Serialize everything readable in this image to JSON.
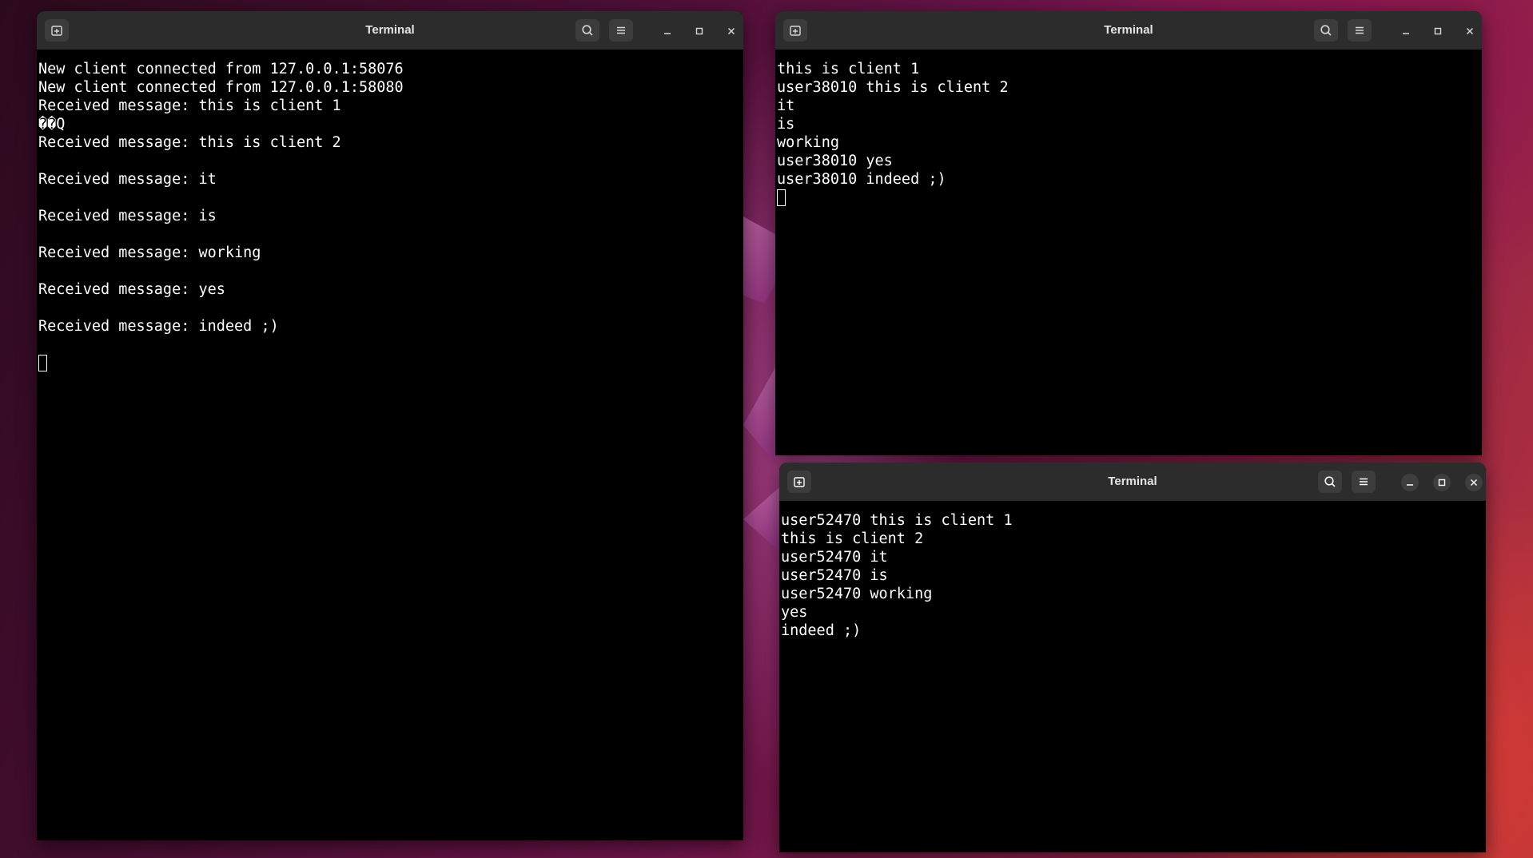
{
  "desktop": {
    "wallpaper": "ubuntu-purple-red-gradient"
  },
  "windows": [
    {
      "title": "Terminal",
      "lines": [
        "New client connected from 127.0.0.1:58076",
        "New client connected from 127.0.0.1:58080",
        "Received message: this is client 1",
        "��Q",
        "Received message: this is client 2",
        "",
        "Received message: it",
        "",
        "Received message: is",
        "",
        "Received message: working",
        "",
        "Received message: yes",
        "",
        "Received message: indeed ;)",
        ""
      ],
      "focused": false
    },
    {
      "title": "Terminal",
      "lines": [
        "this is client 1",
        "user38010 this is client 2",
        "it",
        "is",
        "working",
        "user38010 yes",
        "user38010 indeed ;)"
      ],
      "focused": false
    },
    {
      "title": "Terminal",
      "lines": [
        "user52470 this is client 1",
        "this is client 2",
        "user52470 it",
        "user52470 is",
        "user52470 working",
        "yes",
        "indeed ;)"
      ],
      "focused": true
    }
  ],
  "icons": {
    "new_tab": "new-tab-icon",
    "search": "search-icon",
    "menu": "hamburger-menu-icon",
    "minimize": "minimize-icon",
    "maximize": "maximize-icon",
    "close": "close-icon"
  },
  "colors": {
    "titlebar": "#2c2c2c",
    "terminal_bg": "#000000",
    "terminal_fg": "#ffffff",
    "button_bg": "#3c3c3c"
  }
}
